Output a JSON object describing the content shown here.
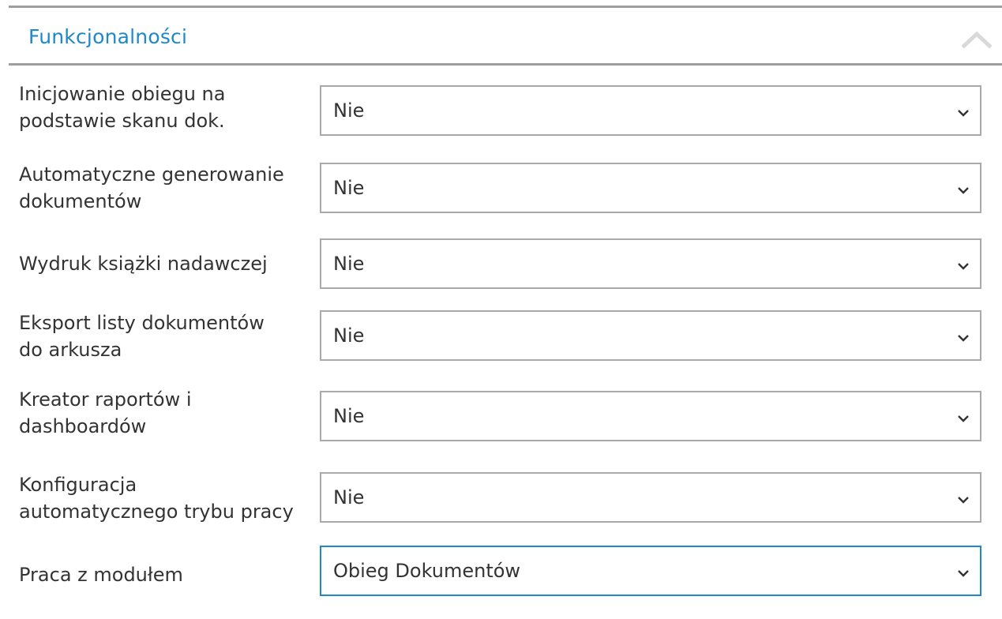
{
  "panel": {
    "title": "Funkcjonalności",
    "collapse_icon": "chevron-up-icon"
  },
  "fields": [
    {
      "label_lines": [
        "Inicjowanie obiegu na",
        "podstawie skanu dok."
      ],
      "value": "Nie"
    },
    {
      "label_lines": [
        "Automatyczne generowanie",
        "dokumentów"
      ],
      "value": "Nie"
    },
    {
      "label_lines": [
        "Wydruk książki nadawczej"
      ],
      "value": "Nie"
    },
    {
      "label_lines": [
        "Eksport listy dokumentów",
        "do arkusza"
      ],
      "value": "Nie"
    },
    {
      "label_lines": [
        "Kreator raportów i",
        "dashboardów"
      ],
      "value": "Nie"
    },
    {
      "label_lines": [
        "Konfiguracja",
        "automatycznego trybu pracy"
      ],
      "value": "Nie"
    },
    {
      "label_lines": [
        "Praca z modułem"
      ],
      "value": "Obieg Dokumentów"
    }
  ],
  "colors": {
    "accent": "#1e88c8",
    "border": "#a9a9a9",
    "divider": "#9e9e9e",
    "text": "#333333"
  }
}
